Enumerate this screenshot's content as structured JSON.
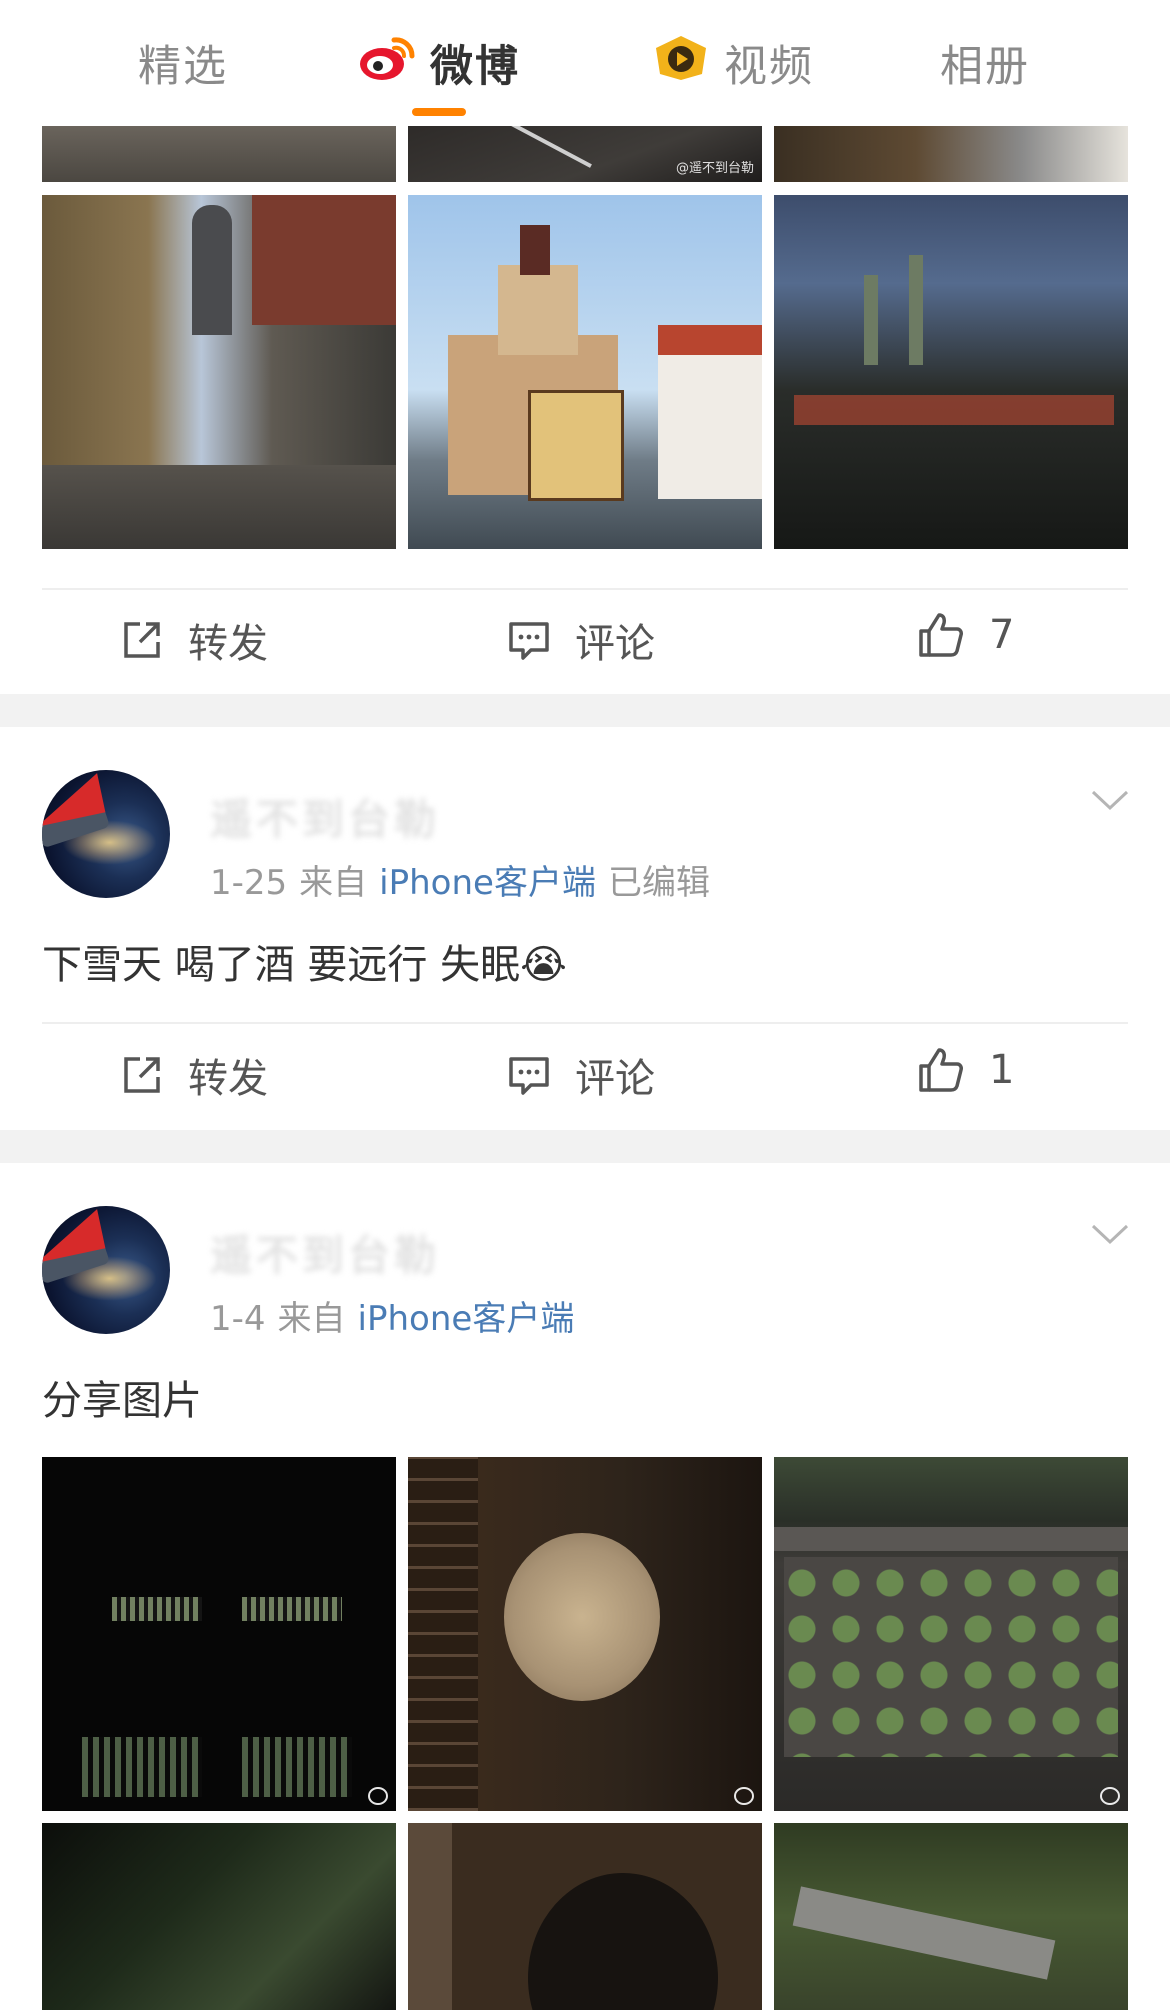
{
  "tabs": [
    {
      "label": "精选",
      "active": false
    },
    {
      "label": "微博",
      "active": true
    },
    {
      "label": "视频",
      "active": false
    },
    {
      "label": "相册",
      "active": false
    }
  ],
  "accent_color": "#ff8200",
  "photo_watermark": "@遥不到台勒",
  "post1": {
    "actions": {
      "repost": "转发",
      "comment": "评论",
      "like_count": "7"
    }
  },
  "post2": {
    "username": "遥不到台勒",
    "date": "1-25",
    "from": "来自",
    "source": "iPhone客户端",
    "edited": "已编辑",
    "text": "下雪天 喝了酒 要远行 失眠😭",
    "actions": {
      "repost": "转发",
      "comment": "评论",
      "like_count": "1"
    }
  },
  "post3": {
    "username": "遥不到台勒",
    "date": "1-4",
    "from": "来自",
    "source": "iPhone客户端",
    "text": "分享图片"
  }
}
